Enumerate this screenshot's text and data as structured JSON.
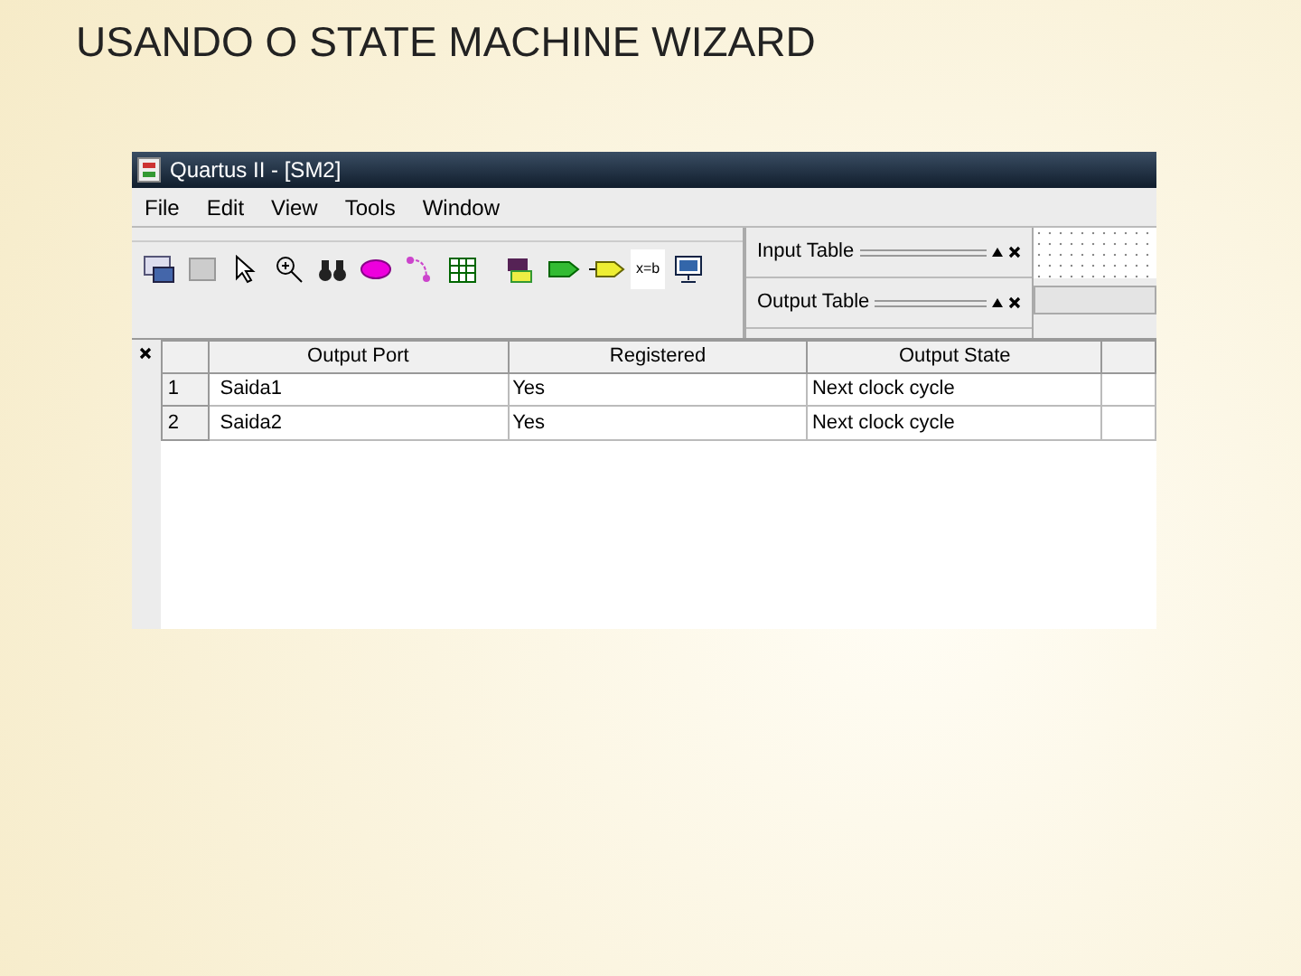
{
  "slide_title": "USANDO O STATE MACHINE WIZARD",
  "window": {
    "title": "Quartus II - [SM2]"
  },
  "menu": [
    "File",
    "Edit",
    "View",
    "Tools",
    "Window"
  ],
  "toolbar": {
    "assign_label": "x=b"
  },
  "panels": [
    {
      "title": "Input Table"
    },
    {
      "title": "Output Table"
    }
  ],
  "table": {
    "columns": [
      "Output Port",
      "Registered",
      "Output State"
    ],
    "rows": [
      {
        "number": "1",
        "cells": [
          "Saida1",
          "Yes",
          "Next clock cycle"
        ]
      },
      {
        "number": "2",
        "cells": [
          "Saida2",
          "Yes",
          "Next clock cycle"
        ]
      }
    ]
  }
}
